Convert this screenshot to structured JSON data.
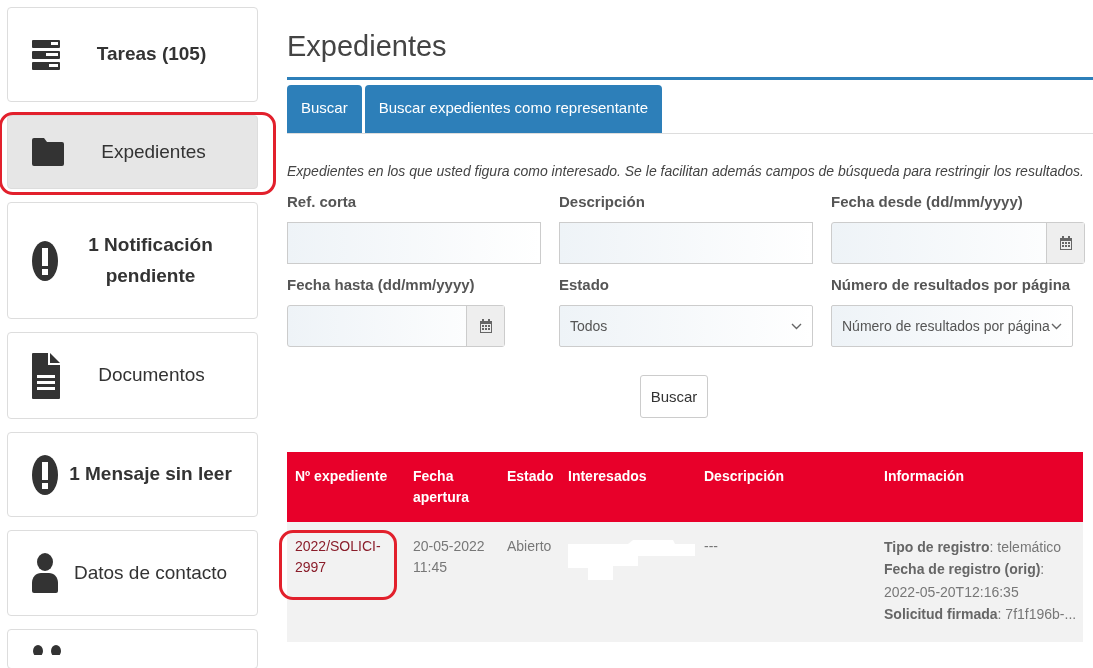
{
  "sidebar": {
    "items": [
      {
        "label": "Tareas (105)",
        "kind": "tasks",
        "bold": true,
        "selected": false,
        "circled": false
      },
      {
        "label": "Expedientes",
        "kind": "folder",
        "bold": false,
        "selected": true,
        "circled": true
      },
      {
        "label": "1 Notificación pendiente",
        "kind": "alert",
        "bold": true,
        "selected": false,
        "circled": false
      },
      {
        "label": "Documentos",
        "kind": "document",
        "bold": false,
        "selected": false,
        "circled": false
      },
      {
        "label": "1 Mensaje sin leer",
        "kind": "alert",
        "bold": true,
        "selected": false,
        "circled": false
      },
      {
        "label": "Datos de contacto",
        "kind": "person",
        "bold": false,
        "selected": false,
        "circled": false
      },
      {
        "kind": "people",
        "selected": false
      }
    ]
  },
  "page_title": "Expedientes",
  "tabs": [
    {
      "label": "Buscar",
      "selected": false
    },
    {
      "label": "Buscar expedientes como representante",
      "selected": false
    }
  ],
  "intro": "Expedientes en los que usted figura como interesado. Se le facilitan además campos de búsqueda para restringir los resultados.",
  "form": {
    "fields": [
      {
        "label": "Ref. corta",
        "kind": "text"
      },
      {
        "label": "Descripción",
        "kind": "text"
      },
      {
        "label": "Fecha desde (dd/mm/yyyy)",
        "kind": "date"
      },
      {
        "label": "Fecha hasta (dd/mm/yyyy)",
        "kind": "date"
      },
      {
        "label": "Estado",
        "kind": "select",
        "value": "Todos"
      },
      {
        "label": "Número de resultados por página",
        "kind": "select",
        "value": "Número de resultados por página"
      }
    ],
    "submit": "Buscar"
  },
  "table": {
    "columns": [
      "Nº expediente",
      "Fecha apertura",
      "Estado",
      "Interesados",
      "Descripción",
      "Información"
    ],
    "rows": [
      {
        "expediente": "2022/SOLICI-2997",
        "circled": true,
        "fecha": "20-05-2022 11:45",
        "estado": "Abierto",
        "descripcion": "---",
        "informacion": [
          {
            "key": "Tipo de registro",
            "value": ": telemático"
          },
          {
            "key": "Fecha de registro (orig)",
            "value": ": 2022-05-20T12:16:35"
          },
          {
            "key": "Solicitud firmada",
            "value": ": 7f1f196b-..."
          }
        ]
      }
    ]
  }
}
